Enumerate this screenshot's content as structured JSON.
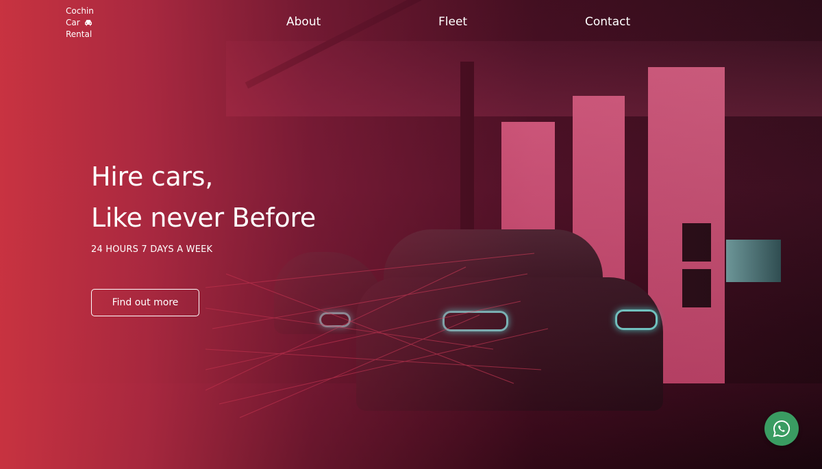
{
  "brand": {
    "line1": "Cochin",
    "line2": "Car",
    "line3": "Rental",
    "icon": "car-icon"
  },
  "nav": {
    "items": [
      {
        "label": "About"
      },
      {
        "label": "Fleet"
      },
      {
        "label": "Contact"
      }
    ]
  },
  "hero": {
    "headline_line1": "Hire cars,",
    "headline_line2": "Like never Before",
    "tagline": "24 HOURS 7 DAYS A WEEK",
    "cta_label": "Find out more"
  },
  "floating": {
    "whatsapp_icon": "whatsapp-icon"
  },
  "colors": {
    "accent_red": "#cd3442",
    "whatsapp_green": "#3a9c62",
    "headlight_teal": "#6ff0e4"
  }
}
